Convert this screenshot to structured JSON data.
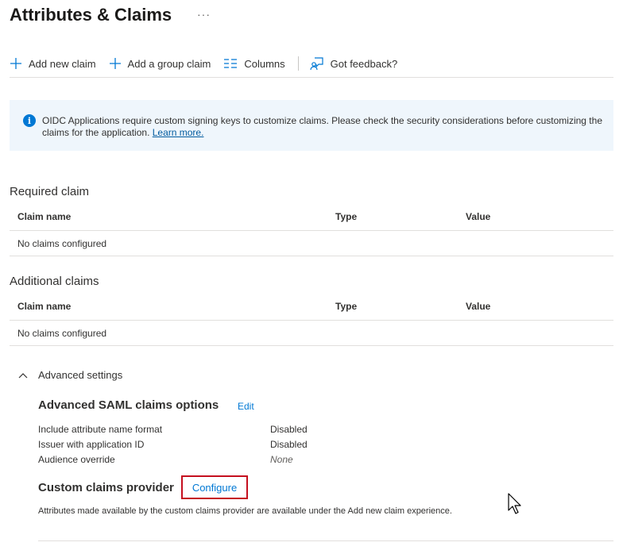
{
  "page": {
    "title": "Attributes & Claims",
    "more": "···"
  },
  "toolbar": {
    "add_new_claim": "Add new claim",
    "add_group_claim": "Add a group claim",
    "columns": "Columns",
    "feedback": "Got feedback?"
  },
  "banner": {
    "text": "OIDC Applications require custom signing keys to customize claims. Please check the security considerations before customizing the claims for the application. ",
    "link": "Learn more."
  },
  "required": {
    "title": "Required claim",
    "columns": [
      "Claim name",
      "Type",
      "Value"
    ],
    "empty": "No claims configured"
  },
  "additional": {
    "title": "Additional claims",
    "columns": [
      "Claim name",
      "Type",
      "Value"
    ],
    "empty": "No claims configured"
  },
  "advanced": {
    "toggle_label": "Advanced settings",
    "saml_title": "Advanced SAML claims options",
    "edit": "Edit",
    "options": [
      {
        "label": "Include attribute name format",
        "value": "Disabled"
      },
      {
        "label": "Issuer with application ID",
        "value": "Disabled"
      },
      {
        "label": "Audience override",
        "value": "None"
      }
    ],
    "provider_title": "Custom claims provider",
    "configure": "Configure",
    "note": "Attributes made available by the custom claims provider are available under the Add new claim experience."
  },
  "colors": {
    "accent": "#0078d4",
    "highlight": "#c50f1f",
    "banner_bg": "#eff6fc"
  }
}
